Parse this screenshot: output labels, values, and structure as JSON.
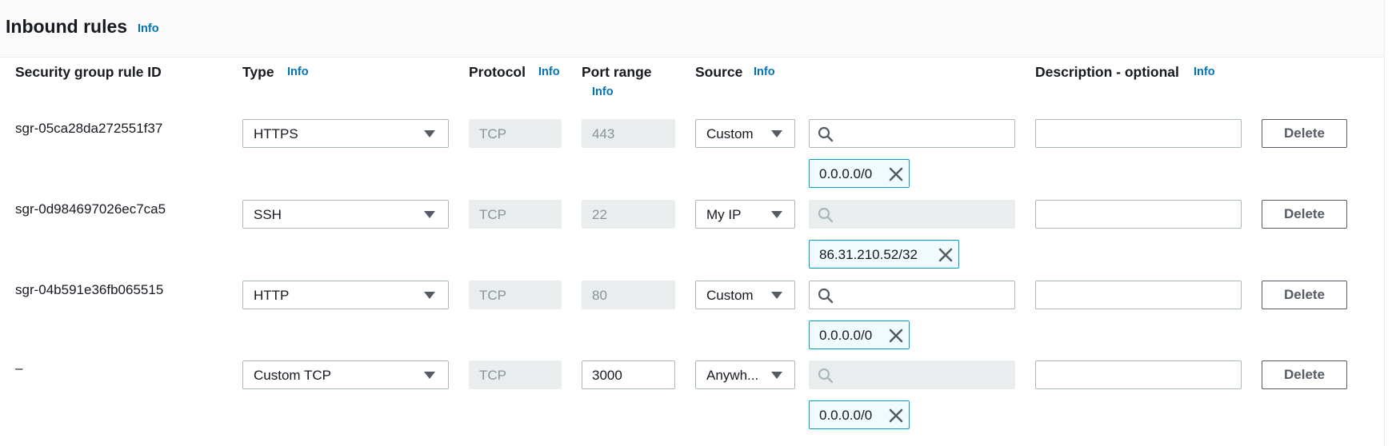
{
  "section": {
    "title": "Inbound rules",
    "info": "Info"
  },
  "columns": {
    "rule_id": "Security group rule ID",
    "type": "Type",
    "type_info": "Info",
    "protocol": "Protocol",
    "protocol_info": "Info",
    "port_range": "Port range",
    "port_range_info": "Info",
    "source": "Source",
    "source_info": "Info",
    "description": "Description - optional",
    "description_info": "Info"
  },
  "rules": [
    {
      "id": "sgr-05ca28da272551f37",
      "type": "HTTPS",
      "protocol": "TCP",
      "port": "443",
      "port_editable": false,
      "source": "Custom",
      "search_disabled": false,
      "cidr": "0.0.0.0/0",
      "description": "",
      "delete_label": "Delete"
    },
    {
      "id": "sgr-0d984697026ec7ca5",
      "type": "SSH",
      "protocol": "TCP",
      "port": "22",
      "port_editable": false,
      "source": "My IP",
      "search_disabled": true,
      "cidr": "86.31.210.52/32",
      "description": "",
      "delete_label": "Delete"
    },
    {
      "id": "sgr-04b591e36fb065515",
      "type": "HTTP",
      "protocol": "TCP",
      "port": "80",
      "port_editable": false,
      "source": "Custom",
      "search_disabled": false,
      "cidr": "0.0.0.0/0",
      "description": "",
      "delete_label": "Delete"
    },
    {
      "id": "–",
      "type": "Custom TCP",
      "protocol": "TCP",
      "port": "3000",
      "port_editable": true,
      "source": "Anywh...",
      "search_disabled": true,
      "cidr": "0.0.0.0/0",
      "description": "",
      "delete_label": "Delete"
    }
  ],
  "icons": {
    "search": "search-icon",
    "remove": "close-icon",
    "dropdown": "caret-down-icon"
  },
  "colors": {
    "link": "#0073bb",
    "token_border": "#00a1c9",
    "token_bg": "#f1faff",
    "disabled_bg": "#eaeded"
  }
}
